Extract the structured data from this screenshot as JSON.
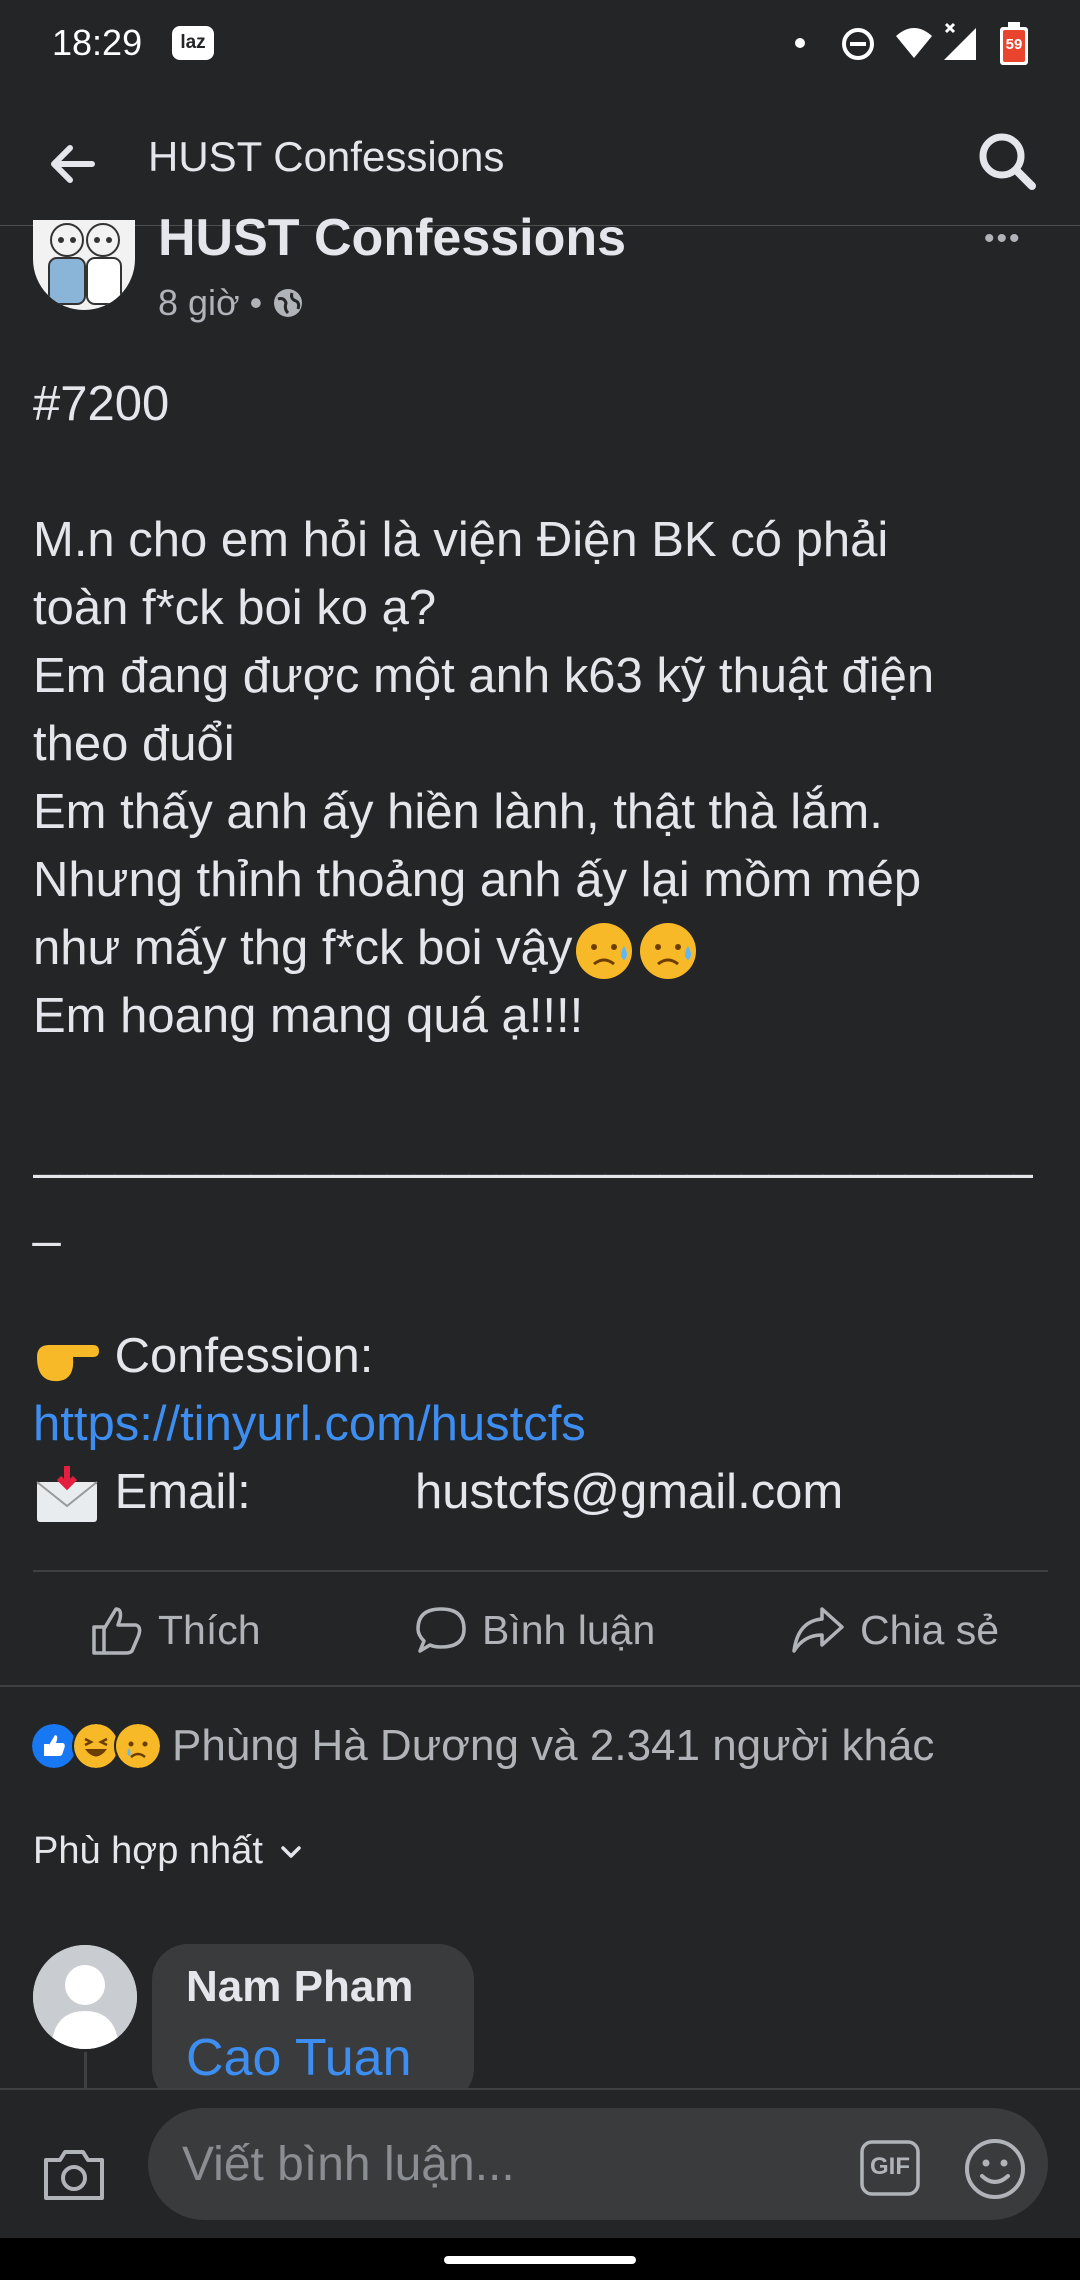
{
  "status_bar": {
    "time": "18:29",
    "app_icon": "laz",
    "battery_level": "59"
  },
  "header": {
    "title": "HUST Confessions"
  },
  "post": {
    "page_name": "HUST Confessions",
    "time_ago": "8 giờ",
    "separator": "•",
    "lines": {
      "l1": "#7200",
      "l2": "M.n cho em hỏi là viện Điện BK có phải",
      "l3": "toàn f*ck boi ko ạ?",
      "l4": "Em đang được một anh k63 kỹ thuật điện",
      "l5": "theo đuổi",
      "l6": "Em thấy anh ấy hiền lành, thật thà lắm.",
      "l7": "Nhưng thỉnh thoảng anh ấy lại mồm mép",
      "l8": "như mấy thg f*ck boi vậy",
      "l9": "Em hoang mang quá ạ!!!!",
      "l10": "________________________________________",
      "l11": "_",
      "confession_label": "Confession:",
      "link": "https://tinyurl.com/hustcfs",
      "email_label": "Email:",
      "email_value": "hustcfs@gmail.com"
    }
  },
  "actions": {
    "like": "Thích",
    "comment": "Bình luận",
    "share": "Chia sẻ"
  },
  "reactions": {
    "summary": "Phùng Hà Dương và 2.341 người khác"
  },
  "sort": {
    "label": "Phù hợp nhất"
  },
  "comment": {
    "author": "Nam Pham",
    "text": "Cao Tuan"
  },
  "composer": {
    "placeholder": "Viết bình luận...",
    "gif_label": "GIF"
  }
}
